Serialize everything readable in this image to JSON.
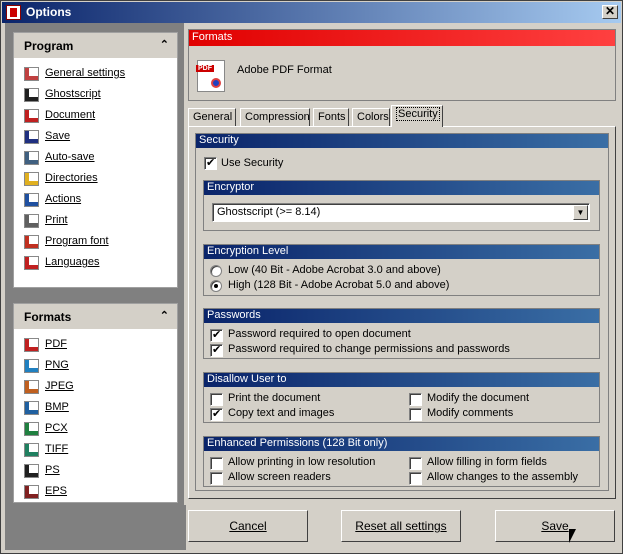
{
  "window": {
    "title": "Options",
    "close_glyph": "✕"
  },
  "program": {
    "heading": "Program",
    "items": [
      {
        "label": "General settings",
        "icon": "general-settings-icon",
        "color": "#c04040"
      },
      {
        "label": "Ghostscript",
        "icon": "ghostscript-icon",
        "color": "#202020"
      },
      {
        "label": "Document",
        "icon": "document-icon",
        "color": "#c02020"
      },
      {
        "label": "Save",
        "icon": "save-icon",
        "color": "#203080"
      },
      {
        "label": "Auto-save",
        "icon": "auto-save-icon",
        "color": "#406080"
      },
      {
        "label": "Directories",
        "icon": "directories-icon",
        "color": "#e0b020"
      },
      {
        "label": "Actions",
        "icon": "actions-icon",
        "color": "#2050a0"
      },
      {
        "label": "Print",
        "icon": "print-icon",
        "color": "#606060"
      },
      {
        "label": "Program font",
        "icon": "program-font-icon",
        "color": "#c03020"
      },
      {
        "label": "Languages",
        "icon": "languages-icon",
        "color": "#c02020"
      }
    ]
  },
  "formats_group": {
    "heading": "Formats",
    "items": [
      {
        "label": "PDF",
        "icon": "pdf-icon",
        "color": "#c02020"
      },
      {
        "label": "PNG",
        "icon": "png-icon",
        "color": "#2080c0"
      },
      {
        "label": "JPEG",
        "icon": "jpeg-icon",
        "color": "#c06020"
      },
      {
        "label": "BMP",
        "icon": "bmp-icon",
        "color": "#2060a0"
      },
      {
        "label": "PCX",
        "icon": "pcx-icon",
        "color": "#208040"
      },
      {
        "label": "TIFF",
        "icon": "tiff-icon",
        "color": "#208060"
      },
      {
        "label": "PS",
        "icon": "ps-icon",
        "color": "#202020"
      },
      {
        "label": "EPS",
        "icon": "eps-icon",
        "color": "#802020"
      }
    ]
  },
  "formats_panel": {
    "heading": "Formats",
    "format_name": "Adobe PDF Format",
    "badge": "PDF"
  },
  "tabs": [
    "General",
    "Compression",
    "Fonts",
    "Colors",
    "Security"
  ],
  "security": {
    "heading": "Security",
    "use_security": {
      "label": "Use Security",
      "checked": true
    },
    "encryptor": {
      "heading": "Encryptor",
      "value": "Ghostscript (>= 8.14)"
    },
    "encryption_level": {
      "heading": "Encryption Level",
      "low": "Low (40 Bit - Adobe Acrobat 3.0 and above)",
      "high": "High (128 Bit - Adobe Acrobat 5.0 and above)",
      "selected": "high"
    },
    "passwords": {
      "heading": "Passwords",
      "open": "Password required to open document",
      "change": "Password required to change permissions and passwords"
    },
    "disallow": {
      "heading": "Disallow User to",
      "print": "Print the document",
      "copy": "Copy text and images",
      "modify_doc": "Modify the document",
      "modify_comments": "Modify comments"
    },
    "enhanced": {
      "heading": "Enhanced Permissions (128 Bit only)",
      "low_res": "Allow printing in low resolution",
      "screen_readers": "Allow screen readers",
      "form_fields": "Allow filling in form fields",
      "assembly": "Allow changes to the assembly"
    }
  },
  "buttons": {
    "cancel": "Cancel",
    "reset": "Reset all settings",
    "save": "Save"
  }
}
